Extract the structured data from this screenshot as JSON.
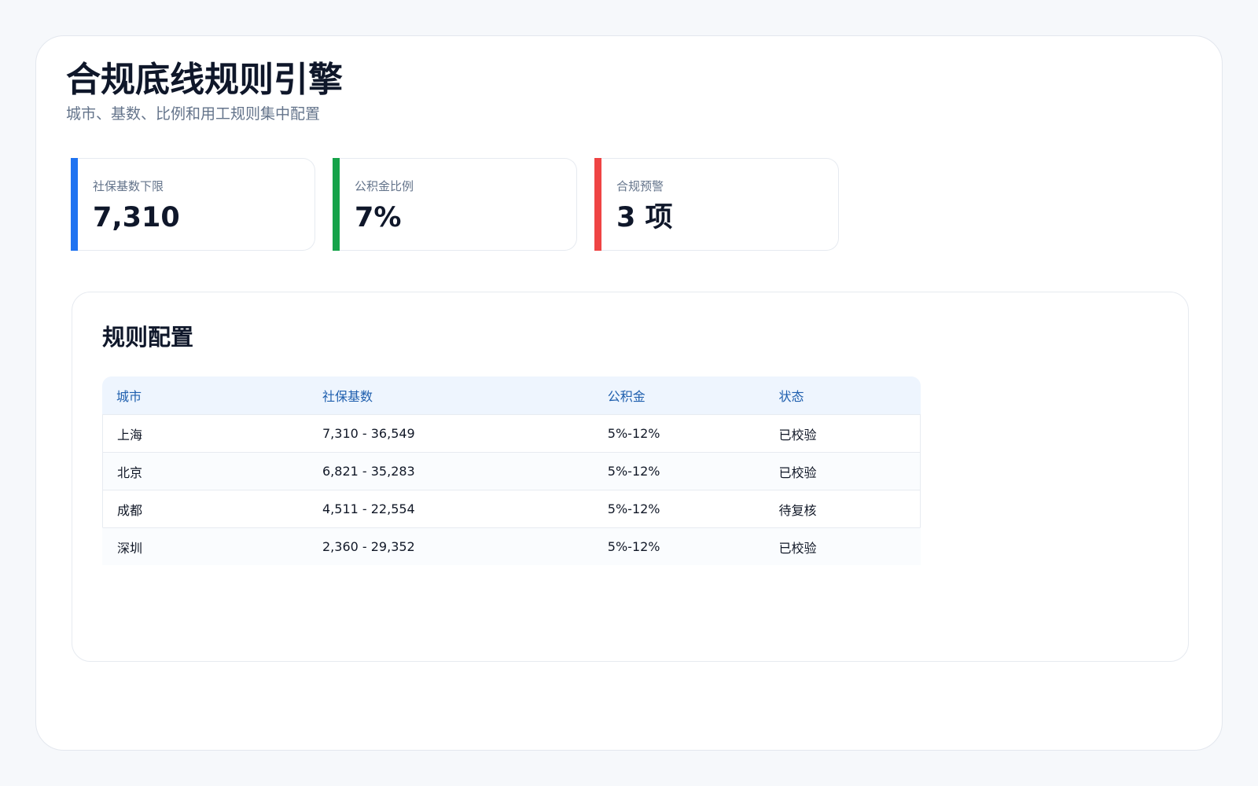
{
  "header": {
    "title": "合规底线规则引擎",
    "subtitle": "城市、基数、比例和用工规则集中配置"
  },
  "stats": [
    {
      "label": "社保基数下限",
      "value": "7,310",
      "accent": "#1f73f1"
    },
    {
      "label": "公积金比例",
      "value": "7%",
      "accent": "#16a34a"
    },
    {
      "label": "合规预警",
      "value": "3 项",
      "accent": "#ef4444"
    }
  ],
  "rules": {
    "title": "规则配置",
    "columns": [
      "城市",
      "社保基数",
      "公积金",
      "状态"
    ],
    "rows": [
      {
        "city": "上海",
        "base": "7,310 - 36,549",
        "fund": "5%-12%",
        "status": "已校验"
      },
      {
        "city": "北京",
        "base": "6,821 - 35,283",
        "fund": "5%-12%",
        "status": "已校验"
      },
      {
        "city": "成都",
        "base": "4,511 - 22,554",
        "fund": "5%-12%",
        "status": "待复核"
      },
      {
        "city": "深圳",
        "base": "2,360 - 29,352",
        "fund": "5%-12%",
        "status": "已校验"
      }
    ]
  }
}
